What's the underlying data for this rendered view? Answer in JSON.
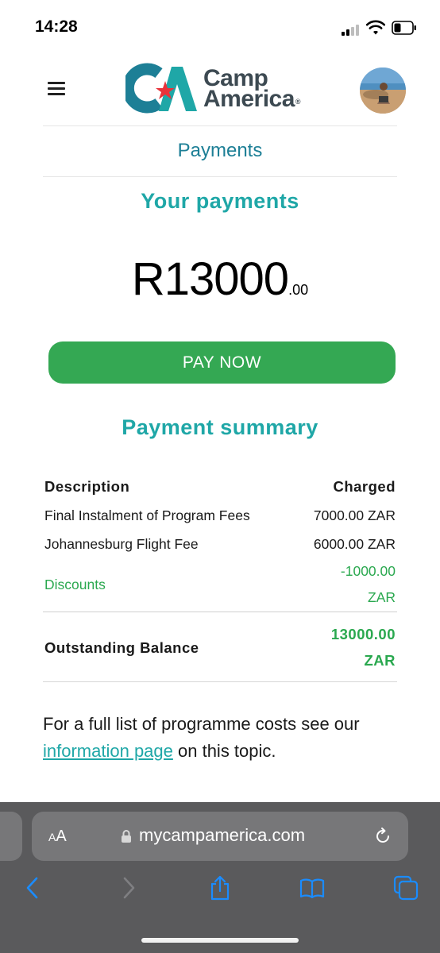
{
  "status_bar": {
    "time": "14:28"
  },
  "header": {
    "logo_line1": "Camp",
    "logo_line2": "America",
    "logo_reg": "®"
  },
  "nav": {
    "payments_label": "Payments"
  },
  "payments": {
    "title": "Your payments",
    "amount_main": "R13000",
    "amount_cents": ".00",
    "pay_button": "PAY NOW"
  },
  "summary": {
    "title": "Payment summary",
    "header": {
      "description": "Description",
      "charged": "Charged"
    },
    "rows": [
      {
        "description": "Final Instalment of Program Fees",
        "charged": "7000.00 ZAR"
      },
      {
        "description": "Johannesburg Flight Fee",
        "charged": "6000.00 ZAR"
      }
    ],
    "discounts": {
      "label": "Discounts",
      "amount": "-1000.00",
      "currency": "ZAR"
    },
    "outstanding": {
      "label": "Outstanding Balance",
      "amount": "13000.00",
      "currency": "ZAR"
    }
  },
  "info": {
    "text_before": "For a full list of programme costs see our ",
    "link_text": "information page",
    "text_after": " on this topic."
  },
  "browser": {
    "aa_small": "A",
    "aa_large": "A",
    "url": "mycampamerica.com"
  },
  "colors": {
    "accent_teal": "#1fa7a7",
    "link_blue": "#1d7f96",
    "pay_green": "#34a853",
    "discount_green": "#2aa84f",
    "logo_red": "#e8333b"
  }
}
